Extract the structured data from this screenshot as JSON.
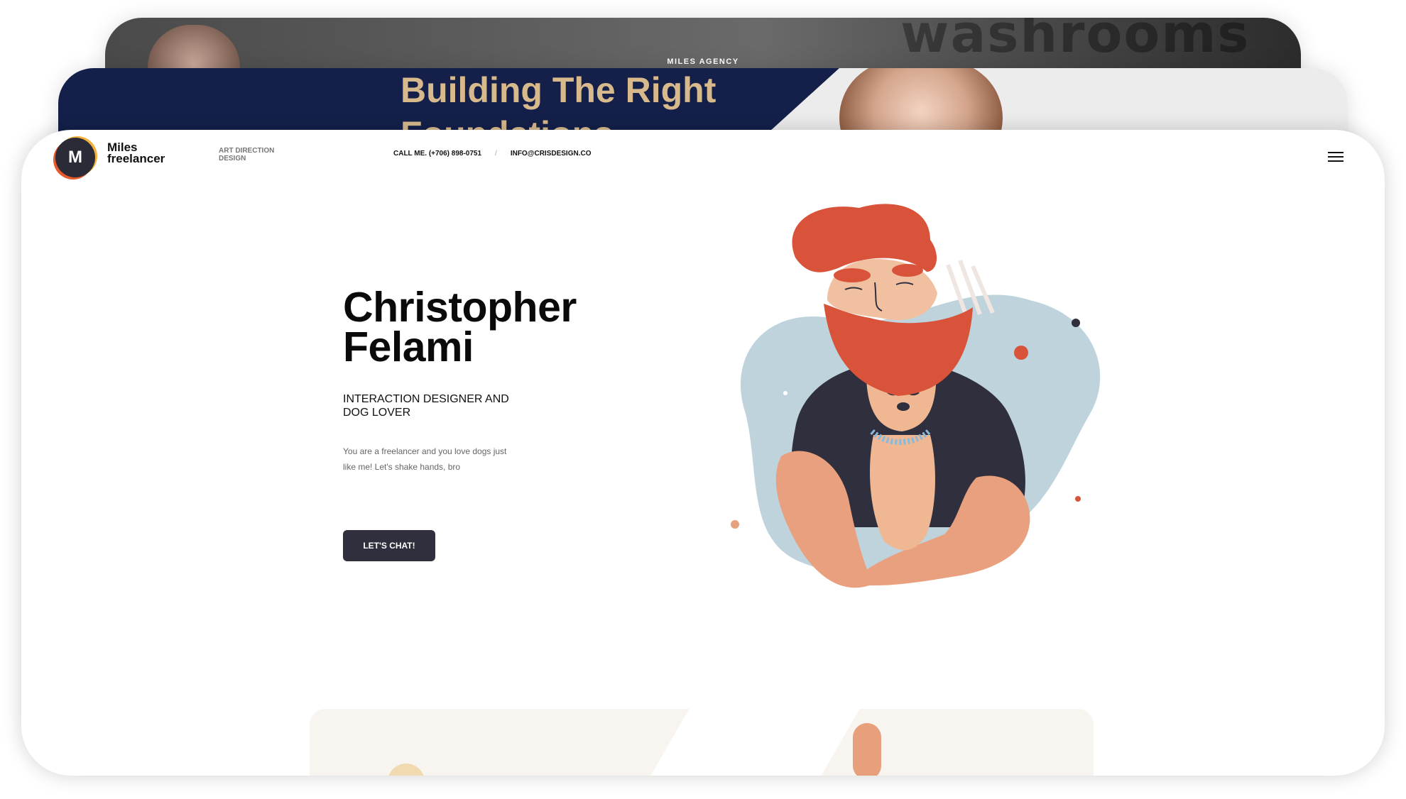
{
  "back_card": {
    "label": "MILES AGENCY"
  },
  "mid_card": {
    "headline": "Building The Right Foundations"
  },
  "header": {
    "logo_letter": "M",
    "brand_line1": "Miles",
    "brand_line2": "freelancer",
    "tagline_line1": "ART DIRECTION",
    "tagline_line2": "DESIGN",
    "phone": "CALL ME. (+706) 898-0751",
    "separator": "/",
    "email": "INFO@CRISDESIGN.CO"
  },
  "hero": {
    "name_line1": "Christopher",
    "name_line2": "Felami",
    "role_line1": "INTERACTION DESIGNER AND",
    "role_line2": "DOG LOVER",
    "desc_line1": "You are a freelancer and you love dogs just",
    "desc_line2": "like me! Let's shake hands, bro",
    "cta_label": "LET'S CHAT!"
  },
  "colors": {
    "accent_dark": "#2f2f3d",
    "beard_red": "#d9533a",
    "blob_blue": "#bfd3dd",
    "gold": "#d7b98c",
    "navy": "#14204a"
  }
}
